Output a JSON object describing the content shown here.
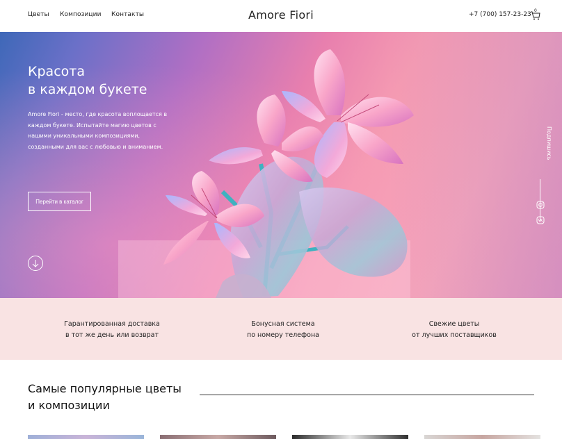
{
  "header": {
    "nav": [
      "Цветы",
      "Композиции",
      "Контакты"
    ],
    "logo": "Amore Fiori",
    "phone": "+7 (700) 157-23-23",
    "cart_count": "0"
  },
  "hero": {
    "title_lines": [
      "Красота",
      "в каждом букете"
    ],
    "description": "Amore Fiori - место, где красота воплощается в каждом букете. Испытайте магию цветов с нашими уникальными композициями, созданными для вас с любовью и вниманием.",
    "button_label": "Перейти в каталог",
    "subscribe_label": "Подпишись"
  },
  "features": [
    {
      "line1": "Гарантированная доставка",
      "line2": "в тот же день или возврат"
    },
    {
      "line1": "Бонусная система",
      "line2": "по номеру телефона"
    },
    {
      "line1": "Свежие цветы",
      "line2": "от лучших поставщиков"
    }
  ],
  "popular": {
    "title_lines": [
      "Самые популярные цветы",
      "и композиции"
    ]
  },
  "colors": {
    "feature_band": "#f9e3e3",
    "hero_blue": "#3e68b8",
    "hero_pink": "#f59bb2"
  }
}
